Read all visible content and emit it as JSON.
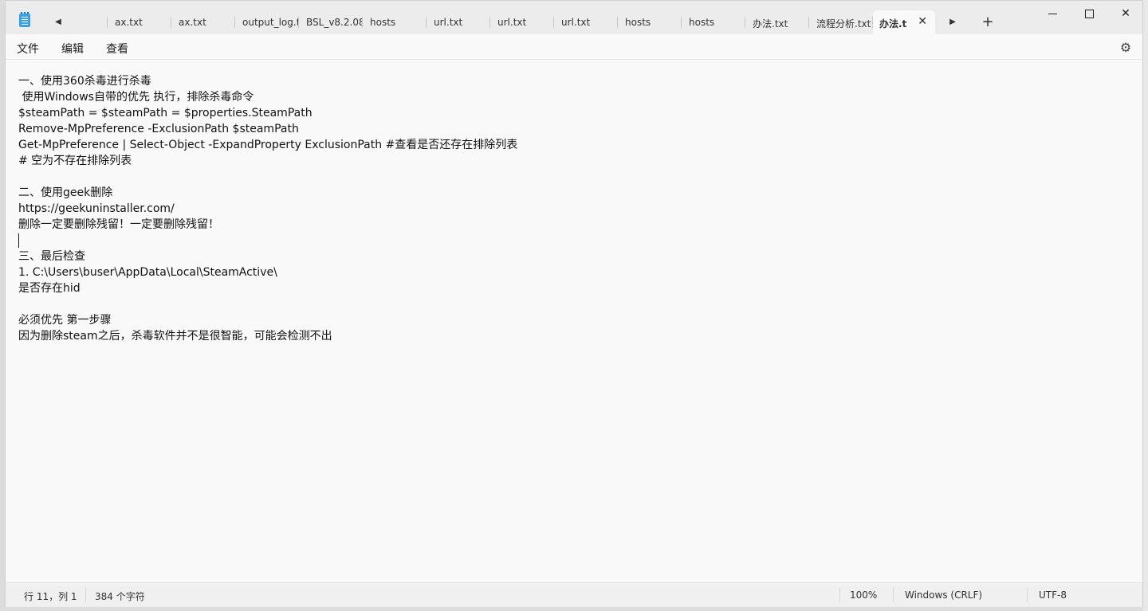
{
  "tabs": [
    {
      "label": "ax.txt"
    },
    {
      "label": "ax.txt"
    },
    {
      "label": "output_log.t"
    },
    {
      "label": "BSL_v8.2.08."
    },
    {
      "label": "hosts"
    },
    {
      "label": "url.txt"
    },
    {
      "label": "url.txt"
    },
    {
      "label": "url.txt"
    },
    {
      "label": "hosts"
    },
    {
      "label": "hosts"
    },
    {
      "label": "办法.txt"
    },
    {
      "label": "流程分析.txt"
    }
  ],
  "active_tab": {
    "label": "办法.t"
  },
  "menu": {
    "file": "文件",
    "edit": "编辑",
    "view": "查看"
  },
  "editor": {
    "lines": [
      "一、使用360杀毒进行杀毒",
      " 使用Windows自带的优先 执行，排除杀毒命令",
      "$steamPath = $steamPath = $properties.SteamPath",
      "Remove-MpPreference -ExclusionPath $steamPath",
      "Get-MpPreference | Select-Object -ExpandProperty ExclusionPath #查看是否还存在排除列表",
      "# 空为不存在排除列表",
      "",
      "二、使用geek删除",
      "https://geekuninstaller.com/",
      "删除一定要删除残留！一定要删除残留！",
      "",
      "三、最后检查",
      "1. C:\\Users\\buser\\AppData\\Local\\SteamActive\\",
      "是否存在hid",
      "",
      "必须优先 第一步骤",
      "因为删除steam之后，杀毒软件并不是很智能，可能会检测不出"
    ]
  },
  "status": {
    "position": "行 11，列 1",
    "char_count": "384 个字符",
    "zoom": "100%",
    "line_ending": "Windows (CRLF)",
    "encoding": "UTF-8"
  },
  "icons": {
    "app": "notepad-icon",
    "settings": "gear-icon",
    "close_tab": "close-icon",
    "scroll_left": "chevron-left-icon",
    "scroll_right": "chevron-right-icon",
    "new_tab": "plus-icon"
  }
}
